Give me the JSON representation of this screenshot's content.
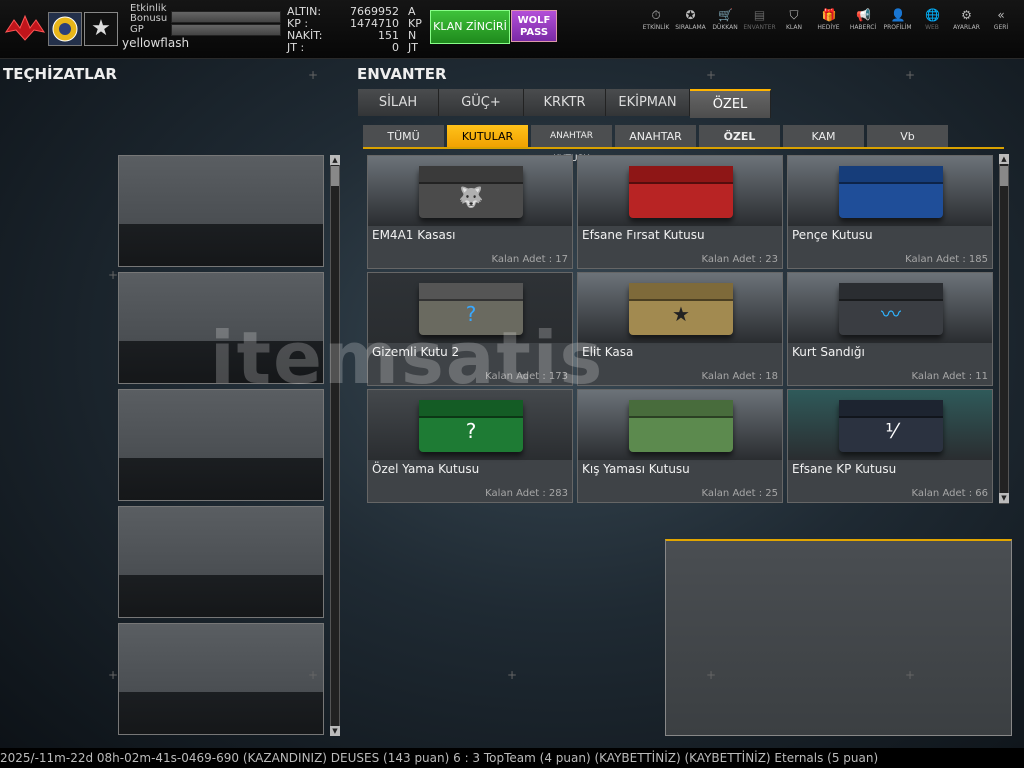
{
  "player": {
    "name": "yellowflash",
    "bonus_label": "Etkinlik Bonusu",
    "gp_label": "GP"
  },
  "currency": [
    {
      "label": "ALTIN:",
      "value": "7669952",
      "unit": "A"
    },
    {
      "label": "KP :",
      "value": "1474710",
      "unit": "KP"
    },
    {
      "label": "NAKİT:",
      "value": "151",
      "unit": "N"
    },
    {
      "label": "JT :",
      "value": "0",
      "unit": "JT"
    }
  ],
  "buttons": {
    "klan": "KLAN ZİNCİRİ",
    "wolf": "WOLF PASS"
  },
  "nav": [
    {
      "label": "ETKİNLİK",
      "icon": "stopwatch-icon",
      "glyph": "⏱"
    },
    {
      "label": "SIRALAMA",
      "icon": "medal-icon",
      "glyph": "✪"
    },
    {
      "label": "DÜKKAN",
      "icon": "cart-icon",
      "glyph": "🛒"
    },
    {
      "label": "ENVANTER",
      "icon": "inventory-icon",
      "glyph": "▤"
    },
    {
      "label": "KLAN",
      "icon": "shield-icon",
      "glyph": "⛉"
    },
    {
      "label": "HEDİYE",
      "icon": "gift-icon",
      "glyph": "🎁"
    },
    {
      "label": "HABERCİ",
      "icon": "megaphone-icon",
      "glyph": "📢"
    },
    {
      "label": "PROFİLİM",
      "icon": "profile-icon",
      "glyph": "👤"
    },
    {
      "label": "WEB",
      "icon": "globe-icon",
      "glyph": "🌐"
    },
    {
      "label": "AYARLAR",
      "icon": "gear-icon",
      "glyph": "⚙"
    },
    {
      "label": "GERİ",
      "icon": "back-icon",
      "glyph": "«"
    }
  ],
  "equip_title": "TEÇHİZATLAR",
  "inv_title": "ENVANTER",
  "tabs": [
    "SİLAH",
    "GÜÇ+",
    "KRKTR",
    "EKİPMAN",
    "ÖZEL"
  ],
  "subtabs": [
    "TÜMÜ",
    "KUTULAR",
    "ANAHTAR KUTUSU",
    "ANAHTAR",
    "ÖZEL EŞYALAR",
    "KAM",
    "Vb"
  ],
  "items": [
    {
      "name": "EM4A1 Kasası",
      "count": "Kalan Adet : 17",
      "box": "#4b4b4b",
      "lid": "#3a3a3a",
      "emb": "🐺",
      "embc": "#e02020",
      "bg": "#6c7379"
    },
    {
      "name": "Efsane Fırsat Kutusu",
      "count": "Kalan Adet : 23",
      "box": "#b82424",
      "lid": "#8e1616",
      "emb": "",
      "embc": "#fff",
      "bg": "#6c7379"
    },
    {
      "name": "Pençe Kutusu",
      "count": "Kalan Adet : 185",
      "box": "#1f4e99",
      "lid": "#163d7a",
      "emb": "",
      "embc": "#fff",
      "bg": "#6c7379"
    },
    {
      "name": "Gizemli Kutu 2",
      "count": "Kalan Adet : 173",
      "box": "#6a6a60",
      "lid": "#555",
      "emb": "?",
      "embc": "#38a8ff",
      "bg": "#2e3236"
    },
    {
      "name": "Elit Kasa",
      "count": "Kalan Adet : 18",
      "box": "#a28a50",
      "lid": "#7e6a3a",
      "emb": "★",
      "embc": "#222",
      "bg": "#6c7379"
    },
    {
      "name": "Kurt Sandığı",
      "count": "Kalan Adet : 11",
      "box": "#3a3d42",
      "lid": "#2a2d31",
      "emb": "〰",
      "embc": "#2fb4ff",
      "bg": "#6c7379"
    },
    {
      "name": "Özel Yama Kutusu",
      "count": "Kalan Adet : 283",
      "box": "#1e7b34",
      "lid": "#145c25",
      "emb": "?",
      "embc": "#fff",
      "bg": "#44484c"
    },
    {
      "name": "Kış Yaması Kutusu",
      "count": "Kalan Adet : 25",
      "box": "#5c8a4e",
      "lid": "#486c3c",
      "emb": "",
      "embc": "#fff",
      "bg": "#6c7379"
    },
    {
      "name": "Efsane KP Kutusu",
      "count": "Kalan Adet : 66",
      "box": "#2b3240",
      "lid": "#1d2430",
      "emb": "⅟",
      "embc": "#fff",
      "bg": "#2f5a5a"
    }
  ],
  "ticker": "2025/-11m-22d 08h-02m-41s-0469-690     (KAZANDINIZ) DEUSES (143 puan) 6 : 3 TopTeam (4 puan) (KAYBETTİNİZ)     (KAYBETTİNİZ) Eternals (5 puan)",
  "watermark": "itemsatis"
}
